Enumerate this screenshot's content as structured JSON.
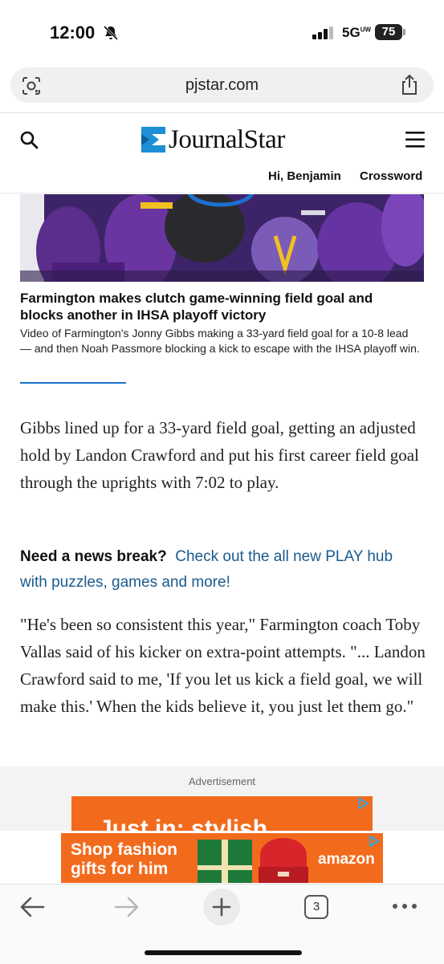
{
  "status_bar": {
    "time": "12:00",
    "network": "5G",
    "network_sup": "UW",
    "battery": "75"
  },
  "browser": {
    "url": "pjstar.com",
    "open_tabs": "3"
  },
  "site_header": {
    "logo_text": "JournalStar",
    "greeting": "Hi, Benjamin",
    "crossword_label": "Crossword"
  },
  "video_caption": {
    "title": "Farmington makes clutch game-winning field goal and blocks another in IHSA playoff victory",
    "body": "Video of Farmington's Jonny Gibbs making a 33-yard field goal for a 10-8 lead — and then Noah Passmore blocking a kick to escape with the IHSA playoff win."
  },
  "article": {
    "paragraph_1": "Gibbs lined up for a 33-yard field goal, getting an adjusted hold by Landon Crawford and put his first career field goal through the uprights with 7:02 to play.",
    "promo_lead": "Need a news break?",
    "promo_link": "Check out the all new PLAY hub with puzzles, games and more!",
    "paragraph_2": "\"He's been so consistent this year,\" Farmington coach Toby Vallas said of his kicker on extra-point attempts. \"... Landon Crawford said to me, 'If you let us kick a field goal, we will make this.' When the kids believe it, you just let them go.\""
  },
  "ads": {
    "label": "Advertisement",
    "ad1_text": "Just in: stylish",
    "ad2_line1": "Shop fashion",
    "ad2_line2": "gifts for him",
    "ad2_brand": "amazon"
  },
  "colors": {
    "accent_blue": "#1a73c9",
    "link_blue": "#1a5a8c",
    "ad_orange": "#f26b1d",
    "logo_blue": "#1d8fd6"
  },
  "icons": [
    "bell-slash-icon",
    "signal-icon",
    "lens-icon",
    "share-icon",
    "search-icon",
    "menu-icon",
    "back-icon",
    "forward-icon",
    "plus-icon",
    "tabs-icon",
    "more-icon"
  ]
}
